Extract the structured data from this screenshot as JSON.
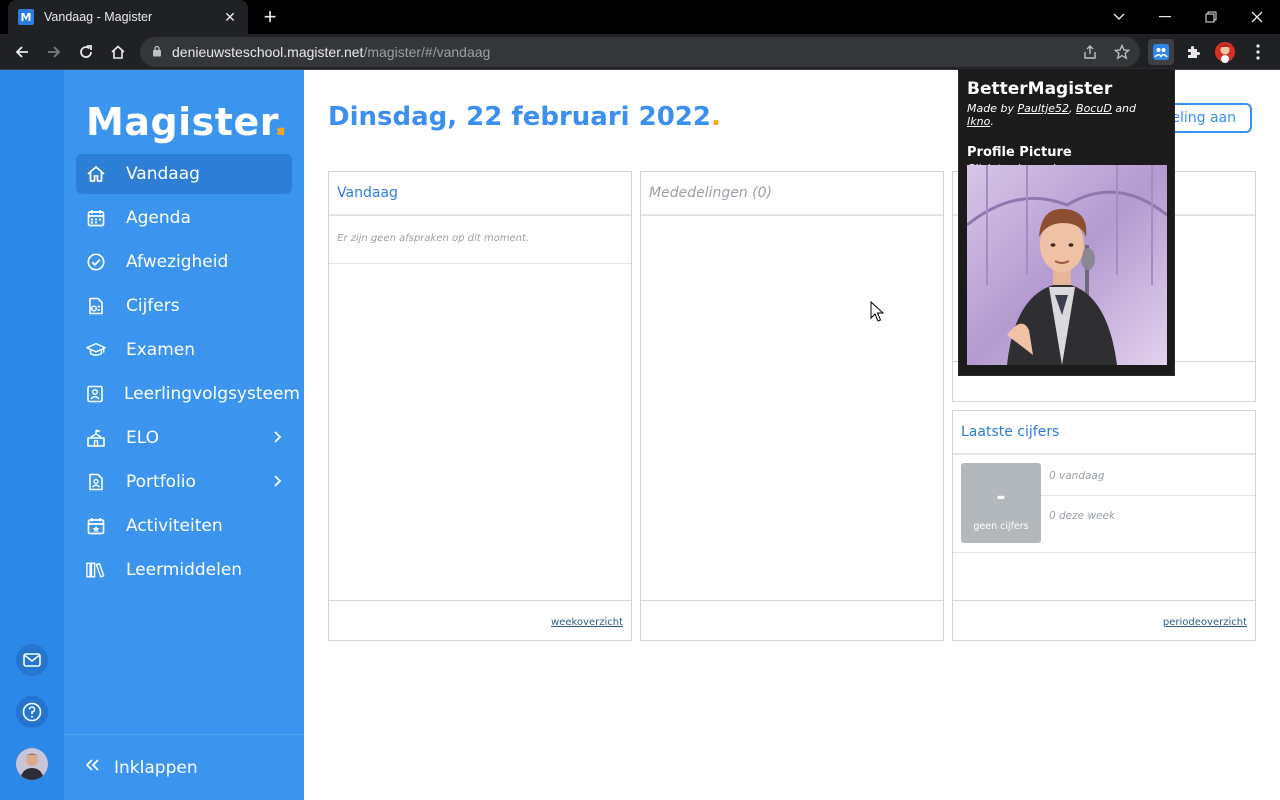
{
  "browser": {
    "tab_title": "Vandaag - Magister",
    "favicon_letter": "M",
    "url_host": "denieuwsteschool.magister.net",
    "url_path": "/magister/#/vandaag"
  },
  "app": {
    "logo": "Magister",
    "logo_dot": ".",
    "accent_color": "#3b8ff0",
    "brand_orange": "#f5a623"
  },
  "sidebar": {
    "items": [
      {
        "label": "Vandaag",
        "icon": "home-icon"
      },
      {
        "label": "Agenda",
        "icon": "calendar-icon"
      },
      {
        "label": "Afwezigheid",
        "icon": "check-circle-icon"
      },
      {
        "label": "Cijfers",
        "icon": "grades-document-icon"
      },
      {
        "label": "Examen",
        "icon": "graduation-cap-icon"
      },
      {
        "label": "Leerlingvolgsysteem",
        "icon": "student-profile-icon"
      },
      {
        "label": "ELO",
        "icon": "school-building-icon"
      },
      {
        "label": "Portfolio",
        "icon": "portfolio-document-icon"
      },
      {
        "label": "Activiteiten",
        "icon": "calendar-star-icon"
      },
      {
        "label": "Leermiddelen",
        "icon": "books-icon"
      }
    ],
    "collapse_label": "Inklappen"
  },
  "main": {
    "date_title": "Dinsdag, 22 februari 2022",
    "title_dot": ".",
    "top_action_label": "eling aan"
  },
  "cards": {
    "today": {
      "title": "Vandaag",
      "empty_message": "Er zijn geen afspraken op dit moment.",
      "footer_link": "weekoverzicht"
    },
    "announcements": {
      "title": "Mededelingen (0)"
    },
    "grades": {
      "title": "Laatste cijfers",
      "grade_value": "-",
      "grade_sub": "geen cijfers",
      "stat_today": "0 vandaag",
      "stat_week": "0 deze week",
      "footer_link": "periodeoverzicht"
    }
  },
  "popup": {
    "title": "BetterMagister",
    "credit_prefix": "Made by",
    "authors": [
      "Paultje52",
      "BocuD",
      "Ikno"
    ],
    "credit_sep": ",",
    "credit_and": "and",
    "credit_end": ".",
    "section_title": "Profile Picture",
    "section_hint": "Click to change!"
  }
}
